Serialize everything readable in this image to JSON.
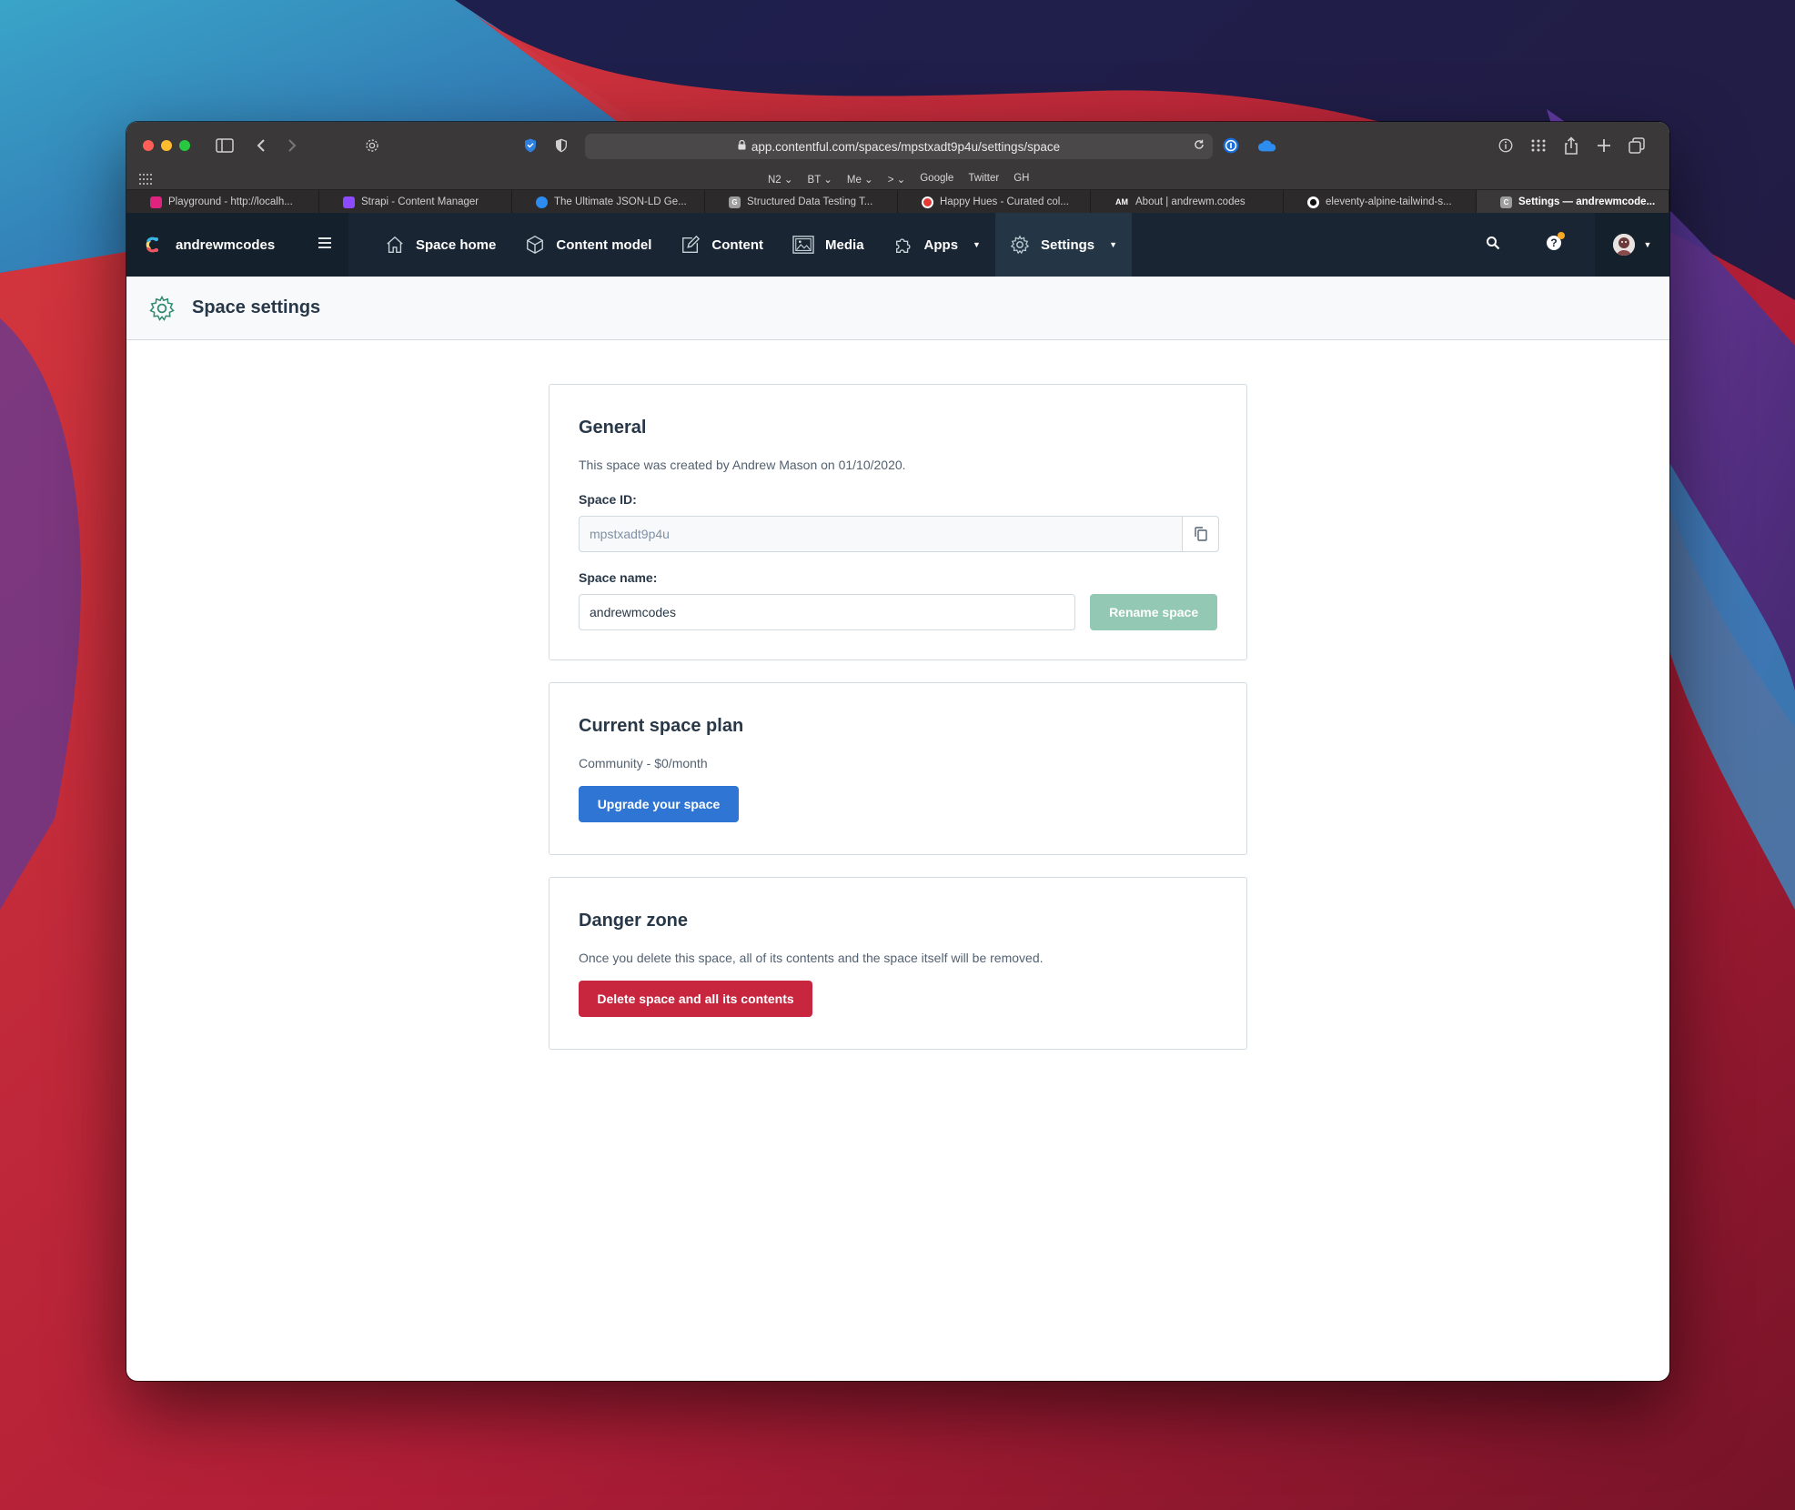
{
  "browser": {
    "url": "app.contentful.com/spaces/mpstxadt9p4u/settings/space",
    "bookmarks": [
      "N2 ⌄",
      "BT ⌄",
      "Me ⌄",
      "> ⌄",
      "Google",
      "Twitter",
      "GH"
    ],
    "tabs": [
      {
        "label": "Playground - http://localh...",
        "favicon_color": "#e0237f",
        "favicon_text": ""
      },
      {
        "label": "Strapi - Content Manager",
        "favicon_color": "#8c4bff",
        "favicon_text": ""
      },
      {
        "label": "The Ultimate JSON-LD Ge...",
        "favicon_color": "#2d8cf0",
        "favicon_text": ""
      },
      {
        "label": "Structured Data Testing T...",
        "favicon_color": "#9e9e9e",
        "favicon_text": "G"
      },
      {
        "label": "Happy Hues - Curated col...",
        "favicon_color": "#e53935",
        "favicon_text": ""
      },
      {
        "label": "About | andrewm.codes",
        "favicon_color": "#2c2a2b",
        "favicon_text": "AM"
      },
      {
        "label": "eleventy-alpine-tailwind-s...",
        "favicon_color": "#ffffff",
        "favicon_text": ""
      },
      {
        "label": "Settings — andrewmcode...",
        "favicon_color": "#9e9e9e",
        "favicon_text": "C"
      }
    ]
  },
  "nav": {
    "org_name": "andrewmcodes",
    "items": [
      {
        "label": "Space home",
        "icon": "home-icon",
        "dropdown": false
      },
      {
        "label": "Content model",
        "icon": "content-model-icon",
        "dropdown": false
      },
      {
        "label": "Content",
        "icon": "edit-icon",
        "dropdown": false
      },
      {
        "label": "Media",
        "icon": "media-icon",
        "dropdown": false
      },
      {
        "label": "Apps",
        "icon": "puzzle-icon",
        "dropdown": true
      },
      {
        "label": "Settings",
        "icon": "gear-icon",
        "dropdown": true
      }
    ],
    "active": "Settings"
  },
  "page": {
    "title": "Space settings"
  },
  "general": {
    "heading": "General",
    "created_text": "This space was created by Andrew Mason on 01/10/2020.",
    "space_id_label": "Space ID:",
    "space_id_value": "mpstxadt9p4u",
    "space_name_label": "Space name:",
    "space_name_value": "andrewmcodes",
    "rename_button": "Rename space"
  },
  "plan": {
    "heading": "Current space plan",
    "plan_text": "Community - $0/month",
    "upgrade_button": "Upgrade your space"
  },
  "danger": {
    "heading": "Danger zone",
    "warning_text": "Once you delete this space, all of its contents and the space itself will be removed.",
    "delete_button": "Delete space and all its contents"
  },
  "colors": {
    "nav_bg": "#192532",
    "primary": "#2e75d4",
    "positive_disabled": "#93c9b4",
    "negative": "#c8263f",
    "gear_green": "#2e8a6a"
  }
}
